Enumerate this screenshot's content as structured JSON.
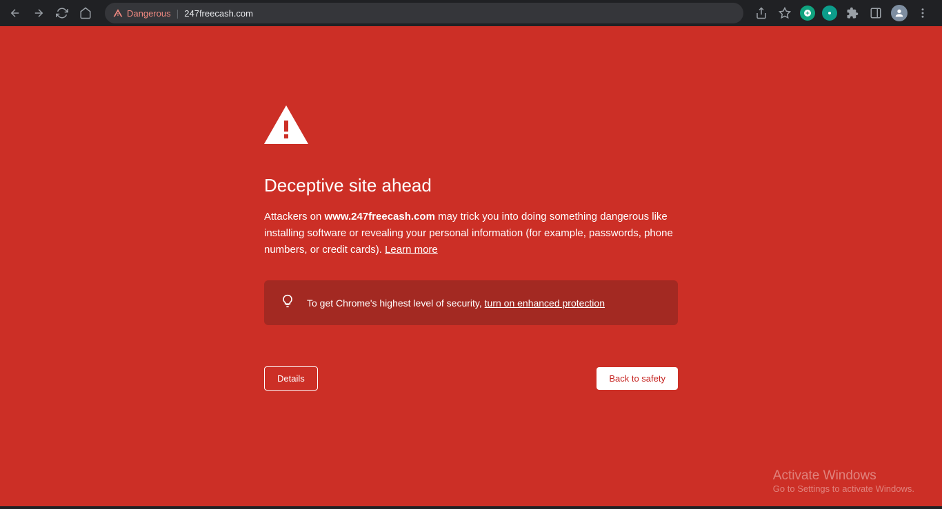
{
  "toolbar": {
    "danger_label": "Dangerous",
    "url": "247freecash.com"
  },
  "warning": {
    "title": "Deceptive site ahead",
    "body_prefix": "Attackers on ",
    "body_domain": "www.247freecash.com",
    "body_suffix": " may trick you into doing something dangerous like installing software or revealing your personal information (for example, passwords, phone numbers, or credit cards). ",
    "learn_more": "Learn more",
    "info_prefix": "To get Chrome's highest level of security, ",
    "info_link": "turn on enhanced protection",
    "details_button": "Details",
    "safety_button": "Back to safety"
  },
  "watermark": {
    "title": "Activate Windows",
    "subtitle": "Go to Settings to activate Windows."
  }
}
